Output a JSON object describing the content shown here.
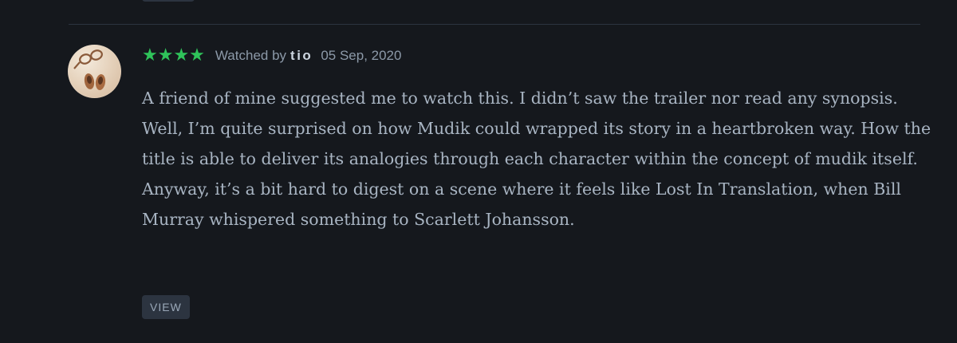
{
  "previous_review": {
    "view_label": ""
  },
  "review": {
    "rating_stars": "★★★★",
    "watched_prefix": "Watched by",
    "author": "tio",
    "date": "05 Sep, 2020",
    "body": "A friend of mine suggested me to watch this. I didn’t saw the trailer nor read any synopsis. Well, I’m quite surprised on how Mudik could wrapped its story in a heartbroken way. How the title is able to deliver its analogies through each character within the concept of mudik itself. Anyway, it’s a bit hard to digest on a scene where it feels like Lost In Translation, when Bill Murray whispered something to Scarlett Johansson.",
    "view_label": "VIEW"
  },
  "colors": {
    "background": "#15181d",
    "star_green": "#2fc35a",
    "meta_text": "#8c99a8",
    "body_text": "#a8b4c2",
    "button_bg": "#2c3440"
  }
}
